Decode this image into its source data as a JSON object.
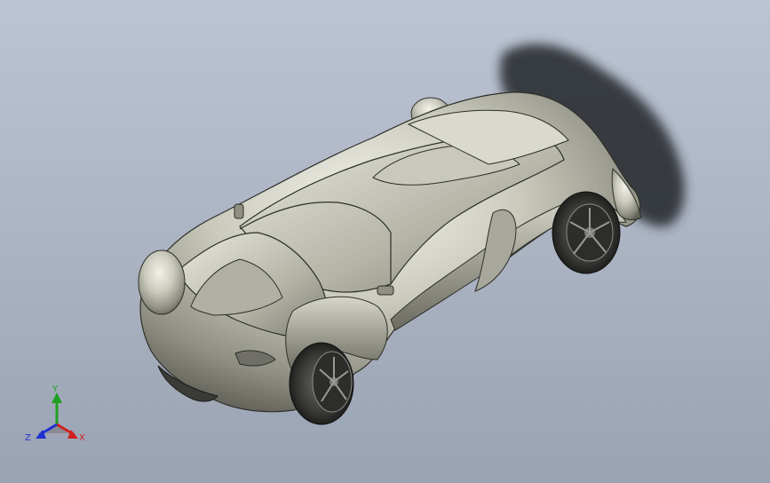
{
  "viewport": {
    "background_top": "#bcc4d3",
    "background_bottom": "#9aa3b3",
    "model_color": "#b8b8aa",
    "shadow_color": "#2b2d33",
    "model_description_icon": "car-model"
  },
  "triad": {
    "x_label": "X",
    "y_label": "Y",
    "z_label": "Z",
    "x_color": "#d02020",
    "y_color": "#20a020",
    "z_color": "#2030d0"
  }
}
